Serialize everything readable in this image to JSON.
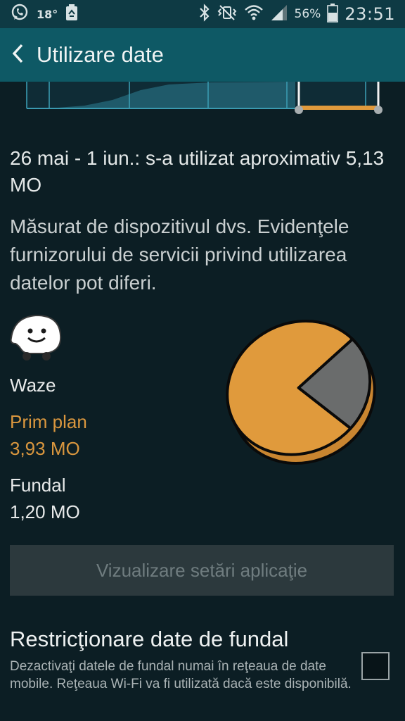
{
  "status_bar": {
    "temperature": "18°",
    "battery_percent": "56%",
    "time": "23:51",
    "icons": [
      "whatsapp-icon",
      "recycle-icon",
      "bluetooth-icon",
      "vibrate-mute-icon",
      "wifi-icon",
      "signal-icon",
      "battery-icon"
    ]
  },
  "app_bar": {
    "title": "Utilizare date",
    "back_icon": "chevron-left-icon"
  },
  "usage": {
    "period_text": "26 mai - 1 iun.: s-a utilizat aproximativ 5,13 MO",
    "note": "Măsurat de dispozitivul dvs. Evidenţele furnizorului de servicii privind utilizarea datelor pot diferi."
  },
  "app": {
    "name": "Waze",
    "icon": "waze-icon",
    "foreground_label": "Prim plan",
    "foreground_value": "3,93 MO",
    "background_label": "Fundal",
    "background_value": "1,20 MO"
  },
  "view_settings_button": "Vizualizare setări aplicaţie",
  "restrict": {
    "title": "Restricţionare date de fundal",
    "description": "Dezactivaţi datele de fundal numai în reţeaua de date mobile. Reţeaua Wi-Fi va fi utilizată dacă este disponibilă.",
    "checked": false
  },
  "colors": {
    "foreground": "#e09a3c",
    "background": "#6a6c6c",
    "accent": "#0e5965"
  },
  "chart_data": {
    "type": "pie",
    "categories": [
      "Prim plan",
      "Fundal"
    ],
    "values": [
      3.93,
      1.2
    ]
  }
}
